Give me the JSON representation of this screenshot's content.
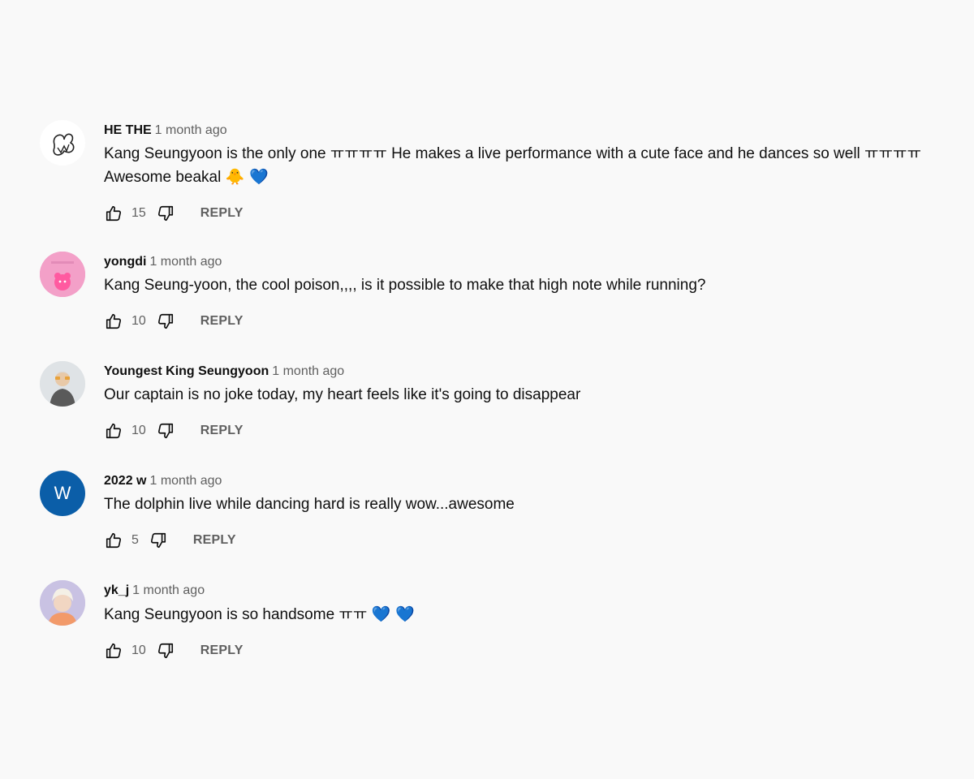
{
  "comments": [
    {
      "author": "HE THE",
      "time": "1 month ago",
      "text": "Kang Seungyoon is the only one ㅠㅠㅠㅠ He makes a live performance with a cute face and he dances so well ㅠㅠㅠㅠ Awesome beakal",
      "emoji": "🐥 💙",
      "likes": "15",
      "reply_label": "REPLY",
      "avatar": "sketch-logo-avatar"
    },
    {
      "author": "yongdi",
      "time": "1 month ago",
      "text": "Kang Seung-yoon, the cool poison,,,, is it possible to make that high note while running?",
      "likes": "10",
      "reply_label": "REPLY",
      "avatar": "pink-bear-avatar"
    },
    {
      "author": "Youngest King Seungyoon",
      "time": "1 month ago",
      "text": "Our captain is no joke today, my heart feels like it's going to disappear",
      "likes": "10",
      "reply_label": "REPLY",
      "avatar": "photo-avatar"
    },
    {
      "author": "2022 w",
      "time": "1 month ago",
      "text": "The dolphin live while dancing hard is really wow...awesome",
      "likes": "5",
      "reply_label": "REPLY",
      "avatar": "letter-avatar",
      "avatar_letter": "W",
      "avatar_color": "#0b5ea8"
    },
    {
      "author": "yk_j",
      "time": "1 month ago",
      "text": "Kang Seungyoon is so handsome ㅠㅠ",
      "emoji": "💙 💙",
      "likes": "10",
      "reply_label": "REPLY",
      "avatar": "photo-avatar"
    }
  ]
}
